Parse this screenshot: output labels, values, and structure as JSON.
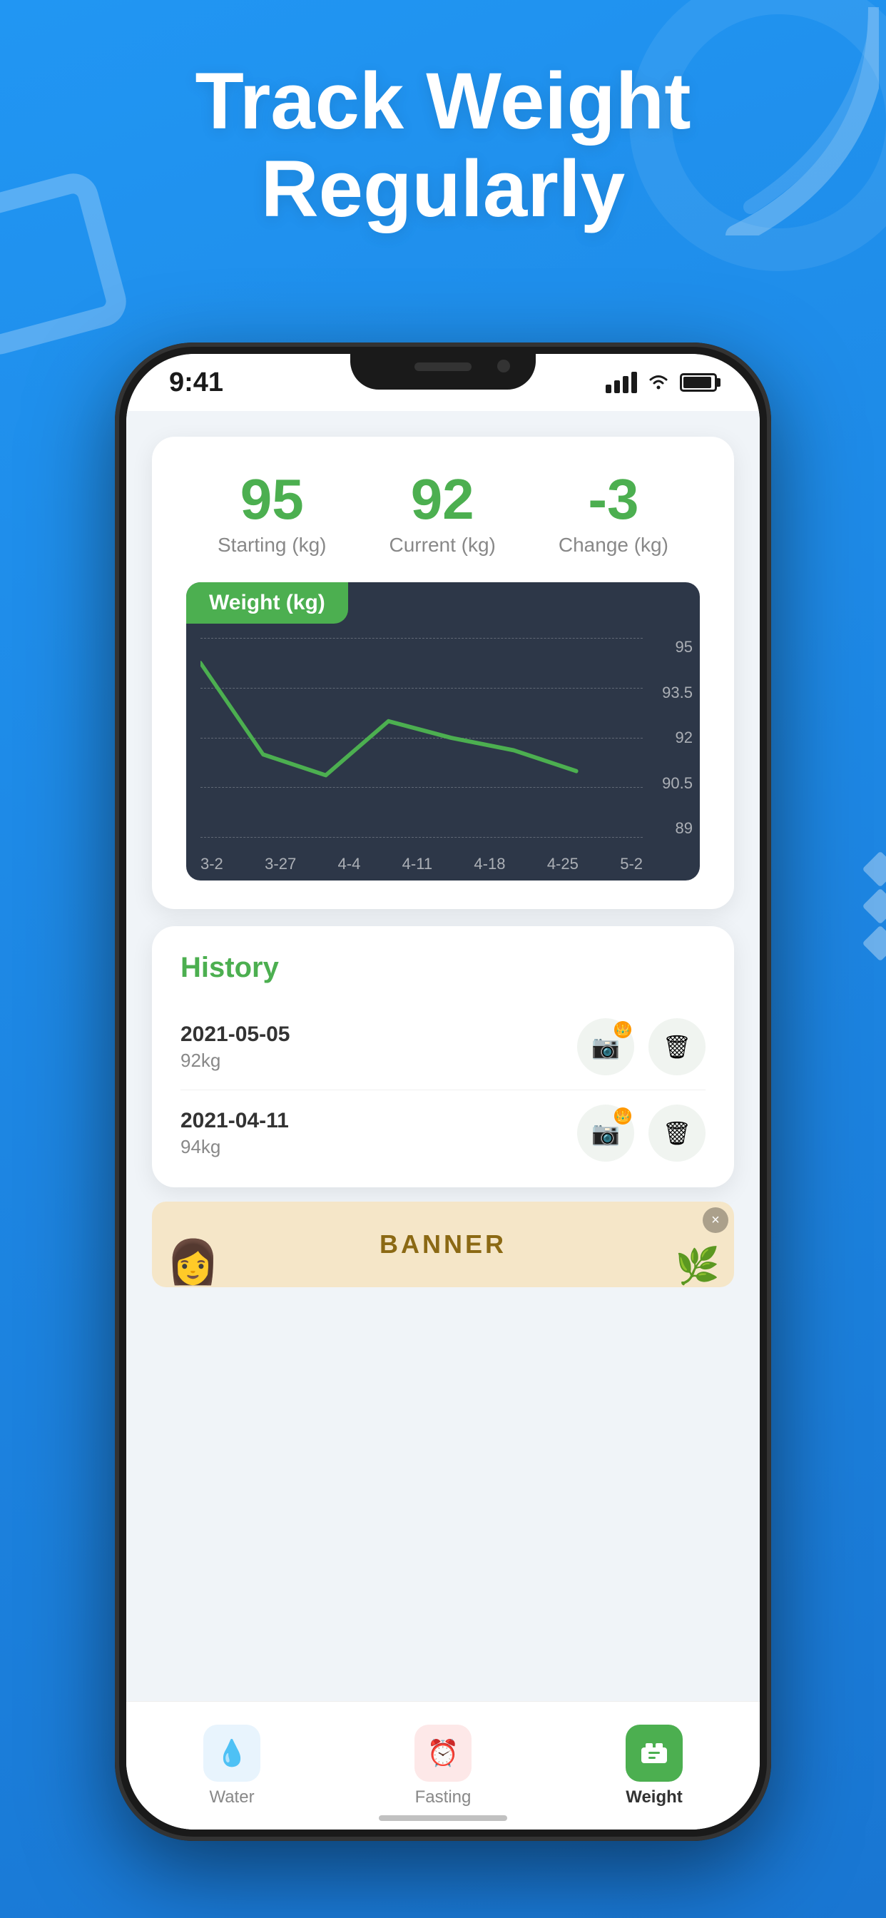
{
  "background": {
    "color": "#2196F3"
  },
  "hero": {
    "title_line1": "Track Weight",
    "title_line2": "Regularly"
  },
  "status_bar": {
    "time": "9:41",
    "signal": "signal",
    "wifi": "wifi",
    "battery": "battery"
  },
  "stats": {
    "starting_value": "95",
    "starting_label": "Starting (kg)",
    "current_value": "92",
    "current_label": "Current (kg)",
    "change_value": "-3",
    "change_label": "Change (kg)"
  },
  "chart": {
    "title": "Weight",
    "unit": "(kg)",
    "y_labels": [
      "95",
      "93.5",
      "92",
      "90.5",
      "89"
    ],
    "x_labels": [
      "3-2",
      "3-27",
      "4-4",
      "4-11",
      "4-18",
      "4-25",
      "5-2"
    ]
  },
  "history": {
    "title": "History",
    "items": [
      {
        "date": "2021-05-05",
        "weight": "92kg"
      },
      {
        "date": "2021-04-11",
        "weight": "94kg"
      }
    ],
    "photo_btn_label": "📷",
    "delete_btn_label": "🗑"
  },
  "banner": {
    "text": "BANNER",
    "close_label": "×"
  },
  "nav": {
    "items": [
      {
        "id": "water",
        "label": "Water",
        "active": false
      },
      {
        "id": "fasting",
        "label": "Fasting",
        "active": false
      },
      {
        "id": "weight",
        "label": "Weight",
        "active": true
      }
    ]
  }
}
